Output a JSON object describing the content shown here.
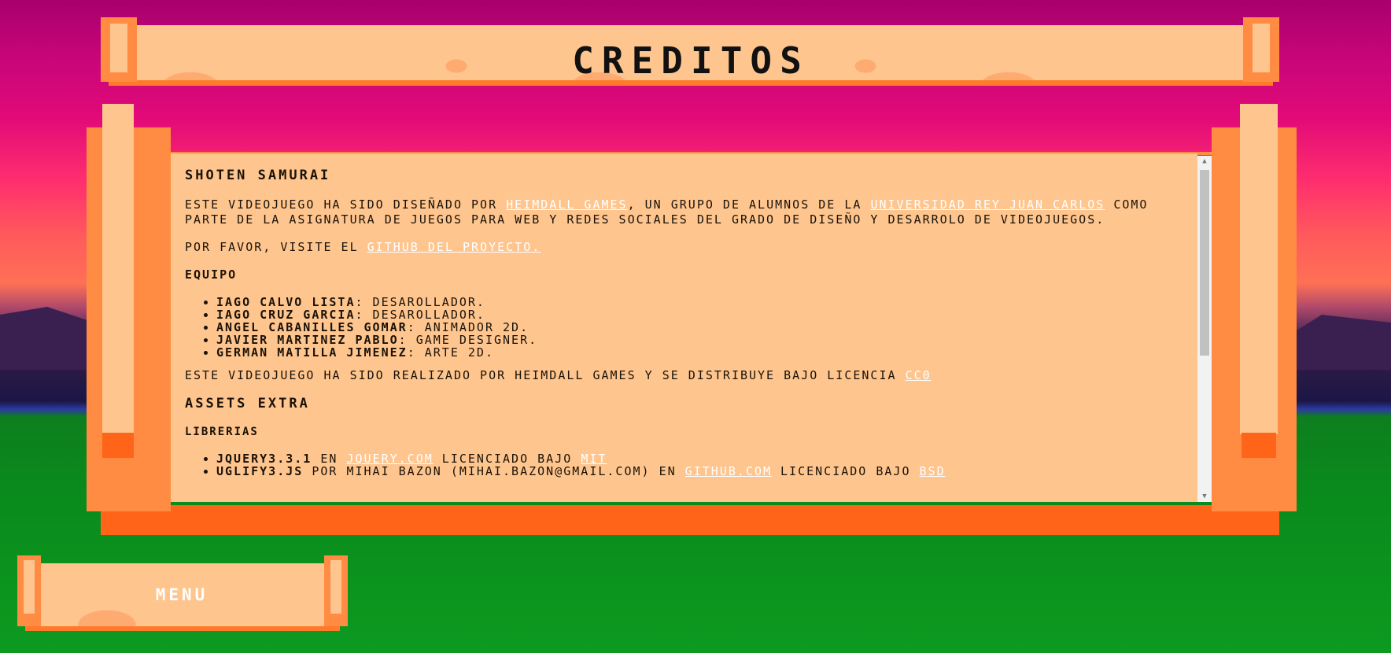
{
  "title": "CREDITOS",
  "content": {
    "heading": "SHOTEN SAMURAI",
    "intro_1": "ESTE VIDEOJUEGO HA SIDO DISEñADO POR ",
    "link_heimdall": "HEIMDALL GAMES",
    "intro_2": ", UN GRUPO DE ALUMNOS DE LA ",
    "link_urjc": "UNIVERSIDAD REY JUAN CARLOS",
    "intro_3": " COMO PARTE DE LA ASIGNATURA DE JUEGOS PARA WEB Y REDES SOCIALES DEL GRADO DE DISEñO Y DESARROLO DE VIDEOJUEGOS.",
    "visit_text": "POR FAVOR, VISITE EL ",
    "link_github": "GITHUB DEL PROYECTO.",
    "team_heading": "EQUIPO",
    "team": [
      {
        "name": "IAGO CALVO LISTA",
        "role": ": DESAROLLADOR."
      },
      {
        "name": "IAGO CRUZ GARCIA",
        "role": ": DESAROLLADOR."
      },
      {
        "name": "ANGEL CABANILLES GOMAR",
        "role": ": ANIMADOR 2D."
      },
      {
        "name": "JAVIER MARTINEZ PABLO",
        "role": ": GAME DESIGNER."
      },
      {
        "name": "GERMAN MATILLA JIMENEZ",
        "role": ": ARTE 2D."
      }
    ],
    "license_text": "ESTE VIDEOJUEGO HA SIDO REALIZADO POR HEIMDALL GAMES Y SE DISTRIBUYE BAJO LICENCIA ",
    "link_cc0": "CC0",
    "assets_heading": "ASSETS EXTRA",
    "libs_heading": "LIBRERIAS",
    "libs": [
      {
        "name": "JQUERY3.3.1",
        "text1": " EN ",
        "link1": "JQUERY.COM",
        "text2": " LICENCIADO BAJO ",
        "link2": "MIT"
      },
      {
        "name": "UGLIFY3.JS",
        "text1": " POR MIHAI BAZON (MIHAI.BAZON@GMAIL.COM) EN ",
        "link1": "GITHUB.COM",
        "text2": " LICENCIADO BAJO ",
        "link2": "BSD"
      }
    ]
  },
  "menu_label": "MENU",
  "colors": {
    "board": "#fec58e",
    "frame": "#ff8c42",
    "frame_dark": "#ff6418",
    "link": "#ffffff"
  }
}
